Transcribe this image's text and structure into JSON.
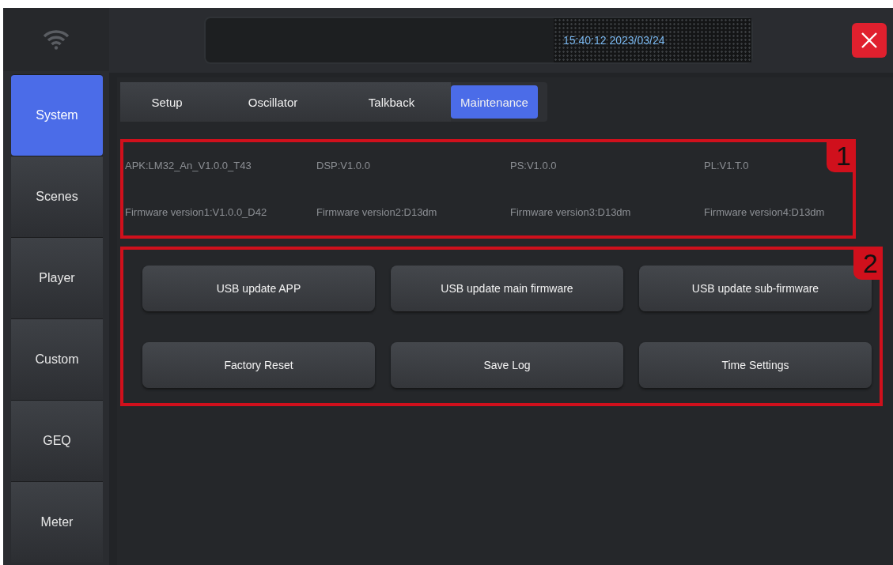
{
  "header": {
    "clock": "15:40:12 2023/03/24"
  },
  "sidebar": [
    {
      "label": "System",
      "selected": true
    },
    {
      "label": "Scenes",
      "selected": false
    },
    {
      "label": "Player",
      "selected": false
    },
    {
      "label": "Custom",
      "selected": false
    },
    {
      "label": "GEQ",
      "selected": false
    },
    {
      "label": "Meter",
      "selected": false
    }
  ],
  "tabs": [
    {
      "label": "Setup",
      "selected": false
    },
    {
      "label": "Oscillator",
      "selected": false
    },
    {
      "label": "Talkback",
      "selected": false
    },
    {
      "label": "Maintenance",
      "selected": true
    }
  ],
  "callouts": [
    {
      "number": "1"
    },
    {
      "number": "2"
    }
  ],
  "versions": [
    [
      "APK:LM32_An_V1.0.0_T43",
      "DSP:V1.0.0",
      "PS:V1.0.0",
      "PL:V1.T.0"
    ],
    [
      "Firmware version1:V1.0.0_D42",
      "Firmware version2:D13dm",
      "Firmware version3:D13dm",
      "Firmware version4:D13dm"
    ]
  ],
  "actions": [
    [
      "USB update APP",
      "USB update main firmware",
      "USB update sub-firmware"
    ],
    [
      "Factory Reset",
      "Save Log",
      "Time Settings"
    ]
  ]
}
